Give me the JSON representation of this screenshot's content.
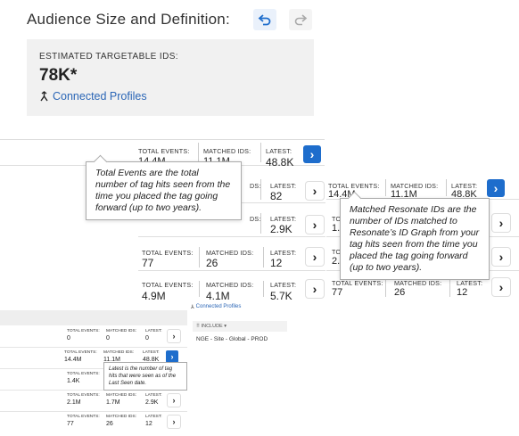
{
  "header": {
    "title": "Audience Size and Definition:"
  },
  "estimate": {
    "label": "ESTIMATED TARGETABLE IDS:",
    "value": "78K*",
    "link": "Connected Profiles"
  },
  "labels": {
    "total": "TOTAL EVENTS:",
    "matched": "MATCHED IDS:",
    "latest": "LATEST:"
  },
  "main_rows": [
    {
      "total": "14.4M",
      "matched": "11.1M",
      "latest": "48.8K"
    },
    {
      "total": "",
      "matched": "",
      "latest": "82"
    },
    {
      "total": "",
      "matched": "",
      "latest": "2.9K"
    },
    {
      "total": "77",
      "matched": "26",
      "latest": "12"
    },
    {
      "total": "4.9M",
      "matched": "4.1M",
      "latest": "5.7K"
    }
  ],
  "right_rows": [
    {
      "total": "14.4M",
      "matched": "11.1M",
      "latest": "48.8K"
    },
    {
      "total": "1.",
      "matched": "",
      "latest": ""
    },
    {
      "total": "2.",
      "matched": "",
      "latest": ""
    },
    {
      "total": "77",
      "matched": "26",
      "latest": "12"
    }
  ],
  "tooltips": {
    "total_events": "Total Events are the total number of tag hits seen from the time you placed the tag going forward (up to two years).",
    "matched": "Matched Resonate IDs are the number of IDs matched to Resonate’s ID Graph from your tag hits seen from the time you placed the tag going forward (up to two years).",
    "latest": "Latest is the number of tag hits that were seen as of the Last Seen date."
  },
  "small": {
    "rows": [
      {
        "total": "0",
        "matched": "0",
        "latest": "0"
      },
      {
        "total": "14.4M",
        "matched": "11.1M",
        "latest": "48.8K"
      },
      {
        "total": "1.4K",
        "matched": "",
        "latest": ""
      },
      {
        "total": "2.1M",
        "matched": "1.7M",
        "latest": "2.9K"
      },
      {
        "total": "77",
        "matched": "26",
        "latest": "12"
      }
    ],
    "connected_profiles": "Connected Profiles",
    "include": "INCLUDE ▾",
    "segment": "NGE - Site - Global - PROD"
  },
  "colors": {
    "accent": "#1e6dcc",
    "link": "#2b66b6",
    "box": "#f1f1f1"
  }
}
